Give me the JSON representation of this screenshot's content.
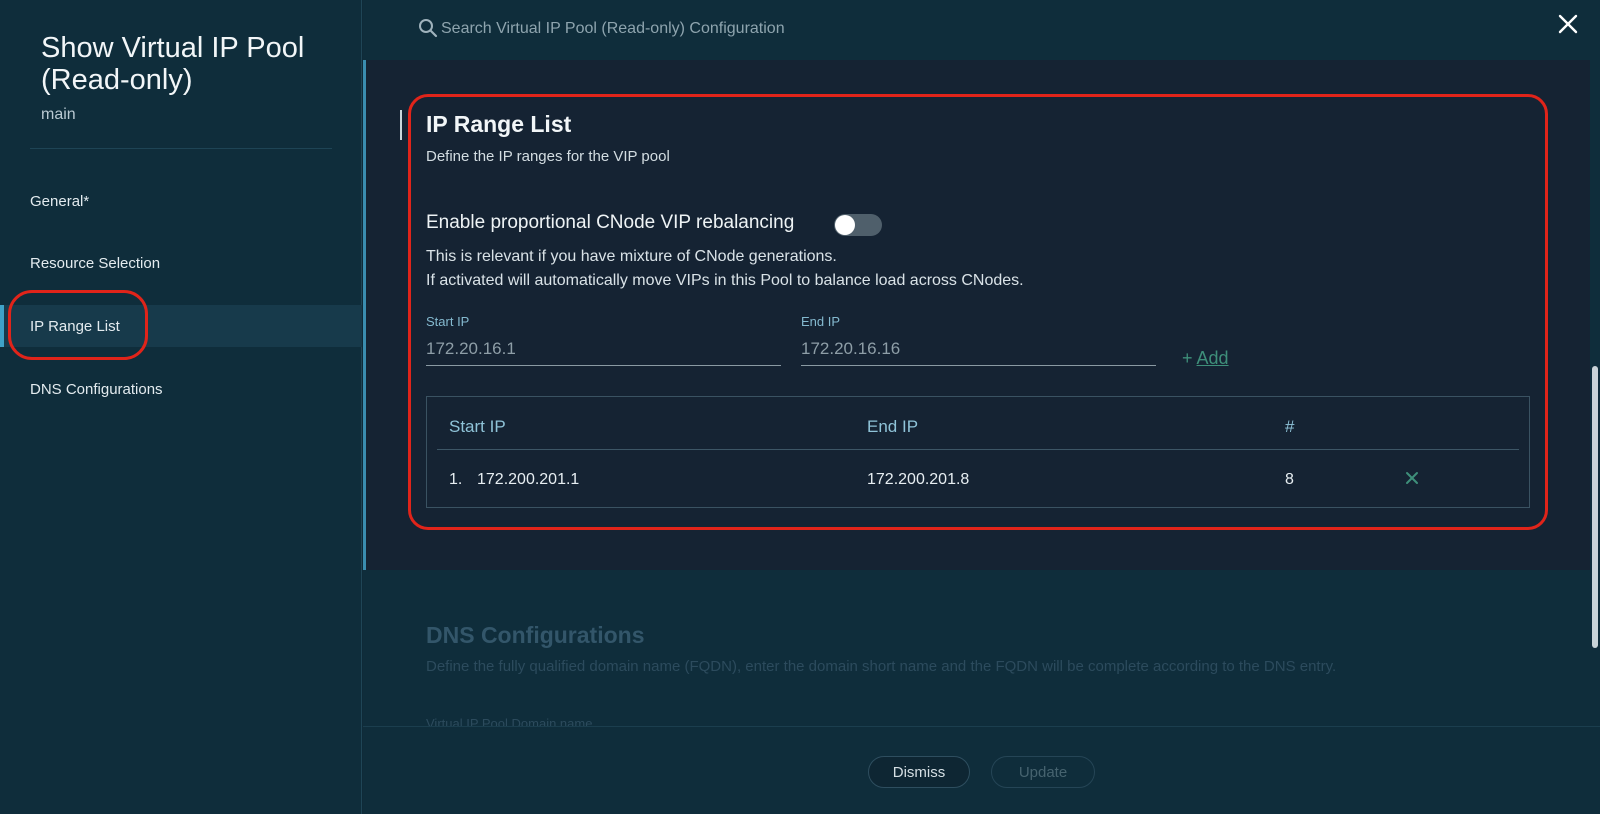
{
  "sidebar": {
    "title": "Show Virtual IP Pool (Read-only)",
    "subtitle": "main",
    "items": [
      {
        "label": "General*"
      },
      {
        "label": "Resource Selection"
      },
      {
        "label": "IP Range List"
      },
      {
        "label": "DNS Configurations"
      }
    ],
    "active_item": "IP Range List"
  },
  "search": {
    "placeholder": "Search Virtual IP Pool (Read-only) Configuration",
    "icon": "search-icon"
  },
  "close_icon": "close-icon",
  "ip_range_section": {
    "title": "IP Range List",
    "description": "Define the IP ranges for the VIP pool",
    "toggle": {
      "label": "Enable proportional CNode VIP rebalancing",
      "enabled": false
    },
    "info_line1": "This is relevant if you have mixture of CNode generations.",
    "info_line2": "If activated will automatically move VIPs in this Pool to balance load across CNodes.",
    "start_ip": {
      "label": "Start IP",
      "placeholder": "172.20.16.1"
    },
    "end_ip": {
      "label": "End IP",
      "placeholder": "172.20.16.16"
    },
    "add_label": "Add",
    "add_prefix": "+",
    "table": {
      "headers": [
        "Start IP",
        "End IP",
        "#"
      ],
      "rows": [
        {
          "index": "1.",
          "start": "172.200.201.1",
          "end": "172.200.201.8",
          "count": "8"
        }
      ]
    }
  },
  "dns_section": {
    "title": "DNS Configurations",
    "description": "Define the fully qualified domain name (FQDN), enter the domain short name and the FQDN will be complete according to the DNS entry.",
    "field_label": "Virtual IP Pool Domain name"
  },
  "footer": {
    "dismiss_label": "Dismiss",
    "update_label": "Update"
  },
  "colors": {
    "accent": "#3fa2c8",
    "highlight": "#e0241a",
    "add_link": "#3e8f7a"
  }
}
